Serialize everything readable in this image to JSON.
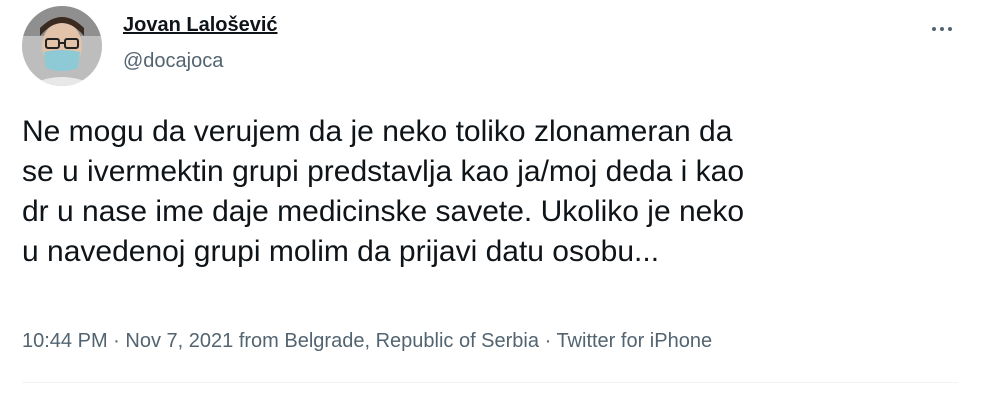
{
  "author": {
    "name": "Jovan Lalošević",
    "handle": "@docajoca",
    "avatar_icon": "profile-photo"
  },
  "more_icon": "more-options-icon",
  "tweet": {
    "lines": [
      "Ne mogu da verujem da je neko toliko zlonameran da",
      "se u ivermektin grupi predstavlja kao ja/moj deda i kao",
      "dr u nase ime daje medicinske savete. Ukoliko je neko",
      "u navedenoj grupi molim da prijavi datu osobu..."
    ]
  },
  "meta": {
    "time": "10:44 PM",
    "date": "Nov 7, 2021",
    "from": "from",
    "location": "Belgrade, Republic of Serbia",
    "separator": "·",
    "source": "Twitter for iPhone"
  },
  "colors": {
    "text": "#0f1419",
    "secondary": "#536471",
    "divider": "#eff3f4"
  }
}
